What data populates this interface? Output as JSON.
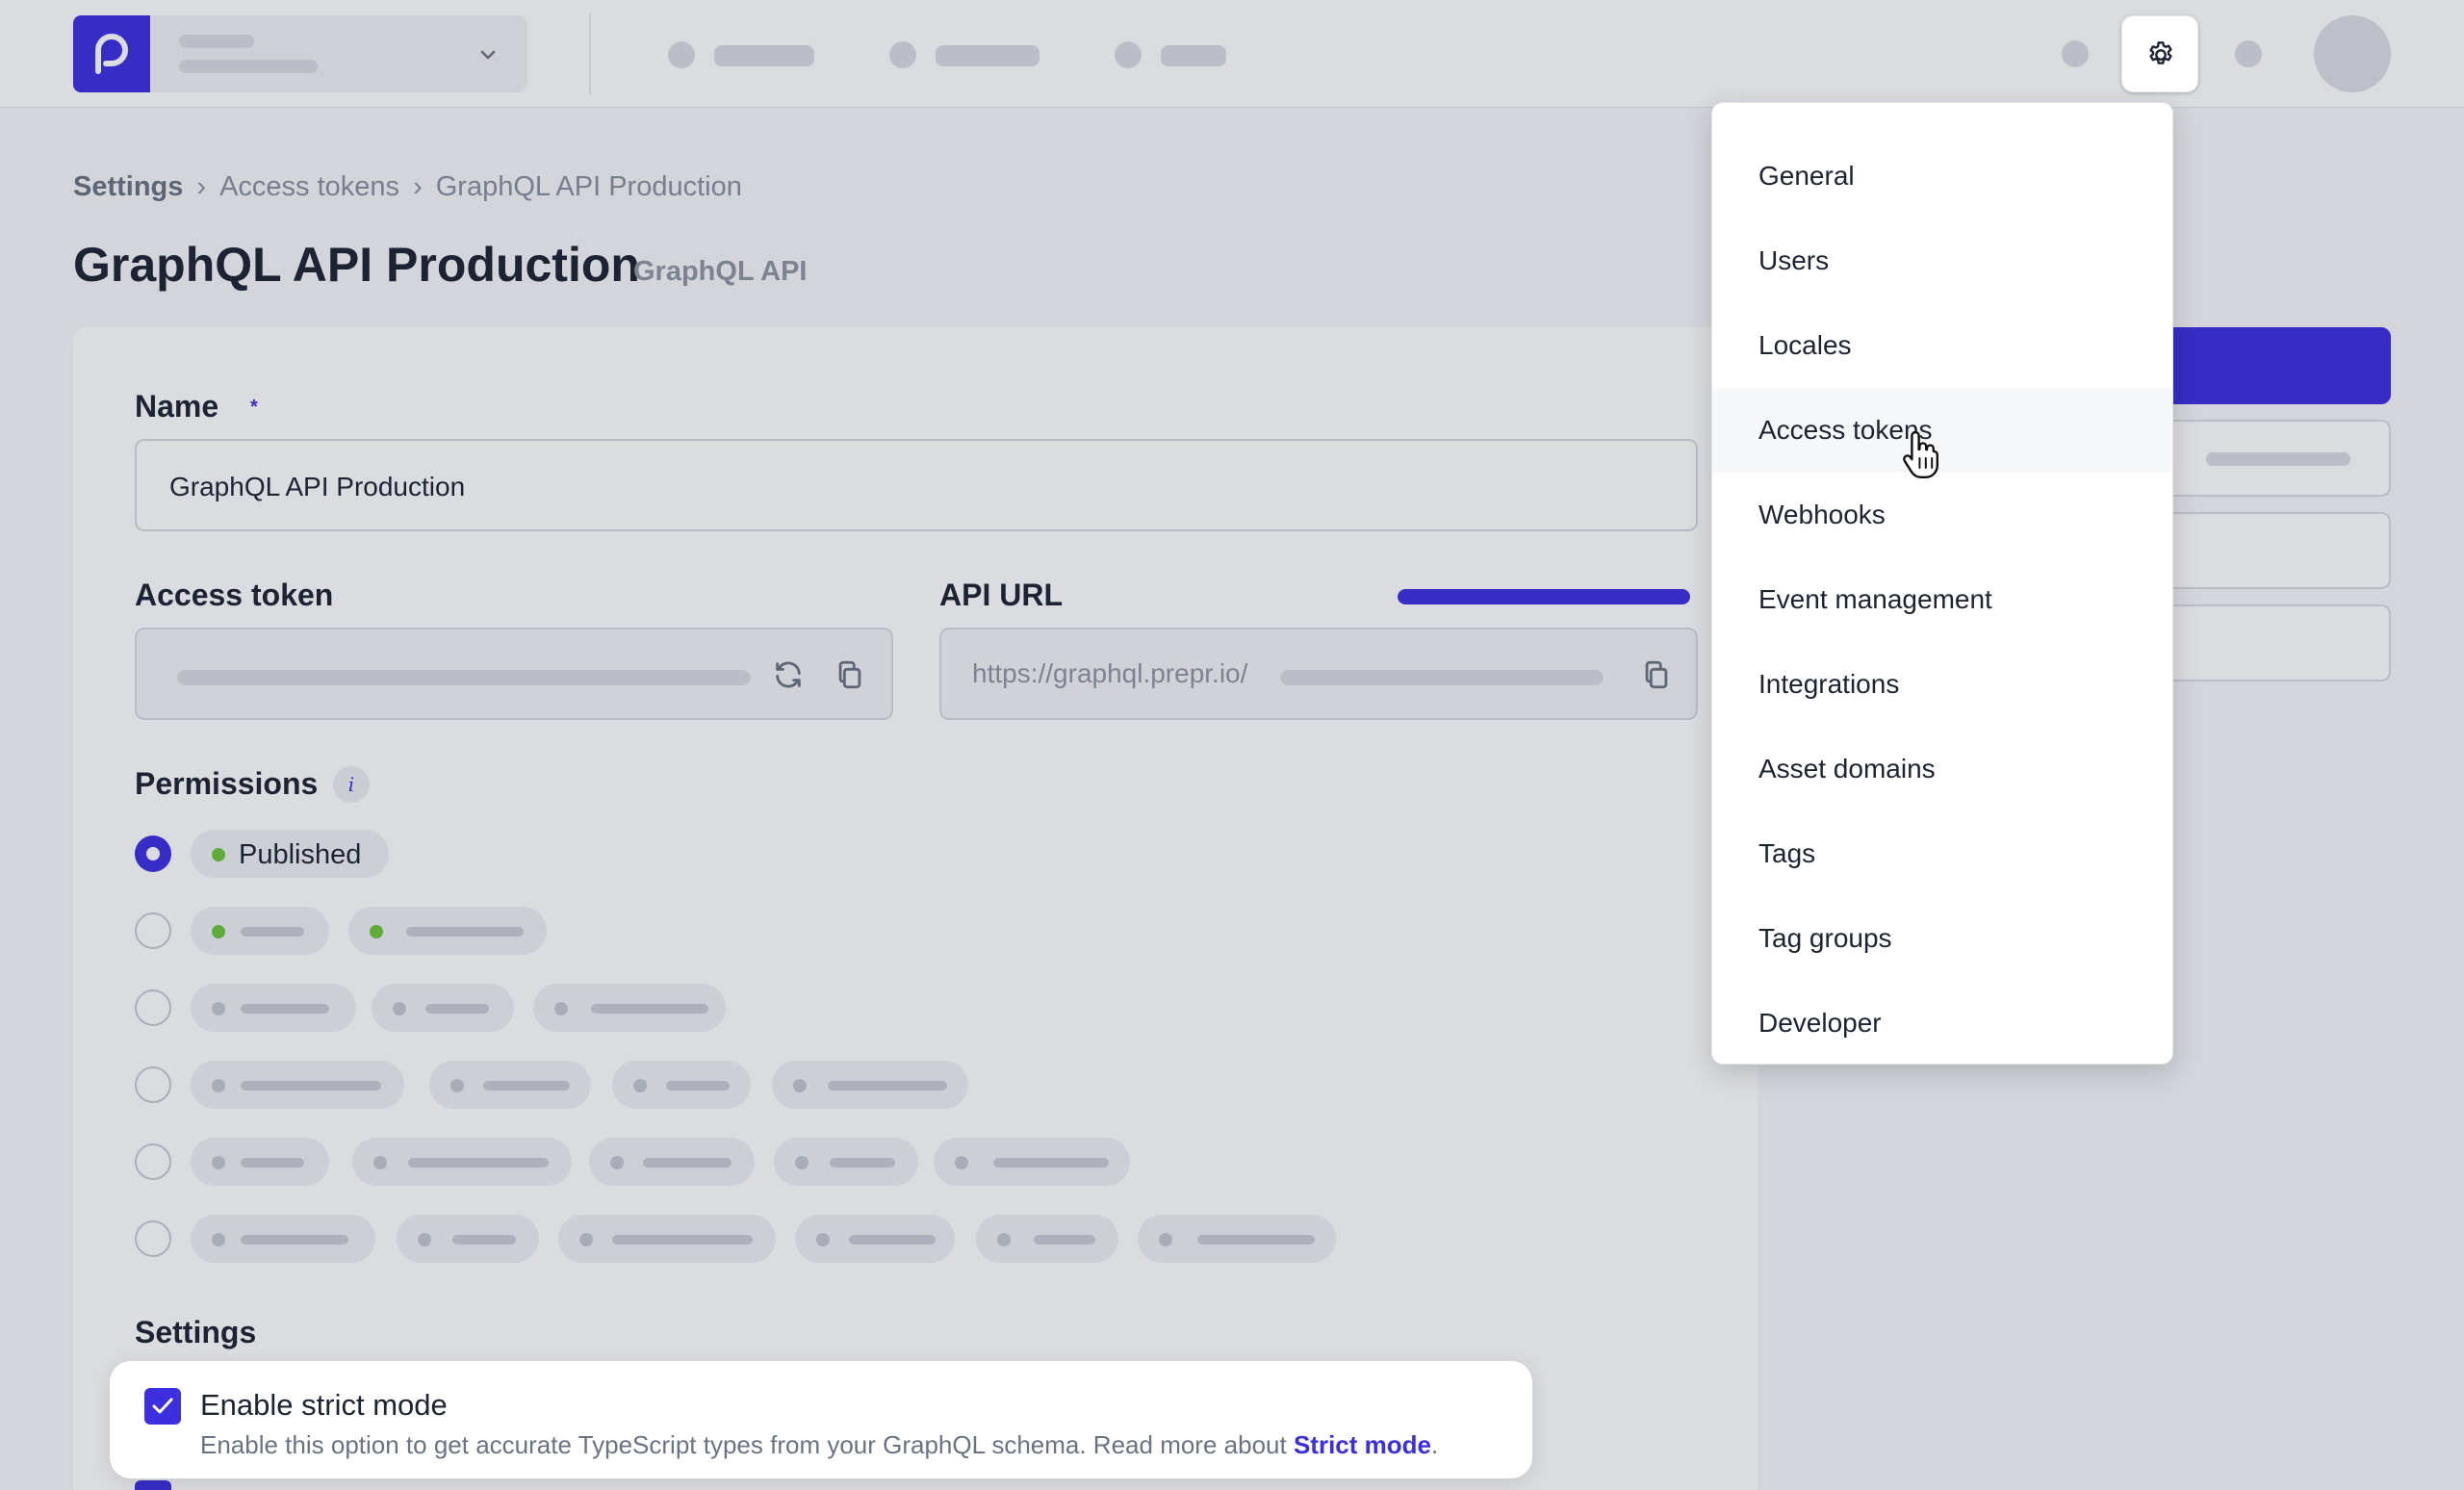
{
  "breadcrumb": {
    "root": "Settings",
    "items": [
      "Access tokens",
      "GraphQL API Production"
    ]
  },
  "page": {
    "title": "GraphQL API Production",
    "tag": "GraphQL API"
  },
  "form": {
    "name_label": "Name",
    "required_mark": "*",
    "name_value": "GraphQL API Production",
    "access_token_label": "Access token",
    "api_url_label": "API URL",
    "api_url_value": "https://graphql.prepr.io/",
    "api_url_progress": 1.0,
    "permissions_label": "Permissions",
    "permissions_info": "i",
    "published_label": "Published",
    "settings_label": "Settings"
  },
  "strict_mode": {
    "title": "Enable strict mode",
    "description": "Enable this option to get accurate TypeScript types from your GraphQL schema. Read more about",
    "link": "Strict mode",
    "suffix": ".",
    "checked": true
  },
  "settings_menu": {
    "items": [
      "General",
      "Users",
      "Locales",
      "Access tokens",
      "Webhooks",
      "Event management",
      "Integrations",
      "Asset domains",
      "Tags",
      "Tag groups",
      "Developer"
    ],
    "hovered": "Access tokens"
  },
  "icons": {
    "logo": "prepr-logo-icon",
    "settings": "gear-icon",
    "regenerate": "refresh-icon",
    "copy": "copy-icon",
    "chevron": "chevron-down-icon",
    "cursor": "hand-pointer-icon",
    "check": "check-icon"
  },
  "colors": {
    "accent": "#3b2fe0",
    "published": "#6cc63a"
  }
}
